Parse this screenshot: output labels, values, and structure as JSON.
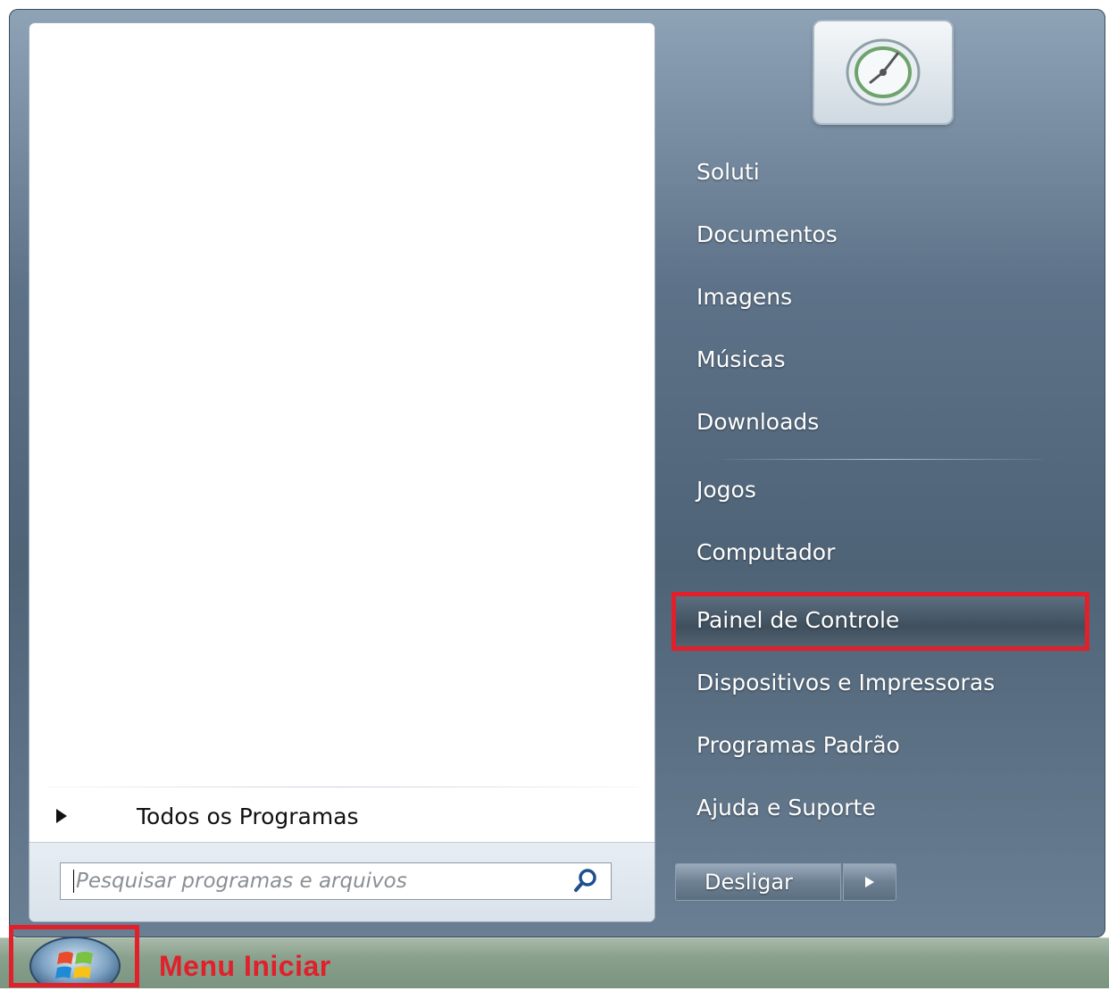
{
  "start_menu": {
    "left_pane": {
      "all_programs_label": "Todos os Programas",
      "search": {
        "placeholder": "Pesquisar programas e arquivos",
        "value": ""
      }
    },
    "right_pane": {
      "items": [
        "Soluti",
        "Documentos",
        "Imagens",
        "Músicas",
        "Downloads",
        "Jogos",
        "Computador",
        "Painel de Controle",
        "Dispositivos e Impressoras",
        "Programas Padrão",
        "Ajuda e Suporte"
      ],
      "highlighted_item": "Painel de Controle",
      "shutdown_label": "Desligar"
    }
  },
  "taskbar": {
    "label": "Menu Iniciar"
  },
  "colors": {
    "annotation_red": "#e0202a",
    "menu_blue": "#5d7288",
    "taskbar_green": "#88a08c"
  }
}
